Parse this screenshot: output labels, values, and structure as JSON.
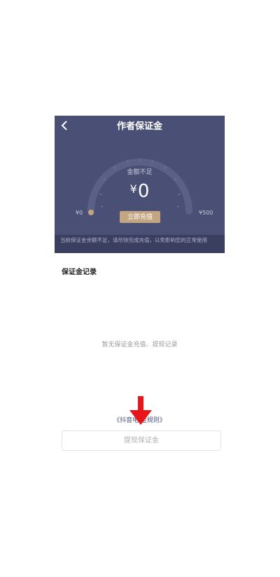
{
  "header": {
    "title": "作者保证金",
    "back_icon": "chevron-left-icon"
  },
  "gauge": {
    "status_label": "金额不足",
    "currency": "¥",
    "amount": "0",
    "min_label": "¥0",
    "max_label": "¥500",
    "value_fraction": 0
  },
  "actions": {
    "recharge_label": "立即充值",
    "withdraw_label": "提现保证金",
    "rules_link": "《抖音电    金规则》"
  },
  "notice": "当前保证金余额不足，请尽快完成充值，以免影响您的正常使用",
  "records": {
    "title": "保证金记录",
    "empty_text": "暂无保证金充值、提现记录"
  },
  "colors": {
    "header_bg": "#4a5075",
    "recharge_bg": "#c3a582",
    "annotation_arrow": "#e8161b"
  }
}
